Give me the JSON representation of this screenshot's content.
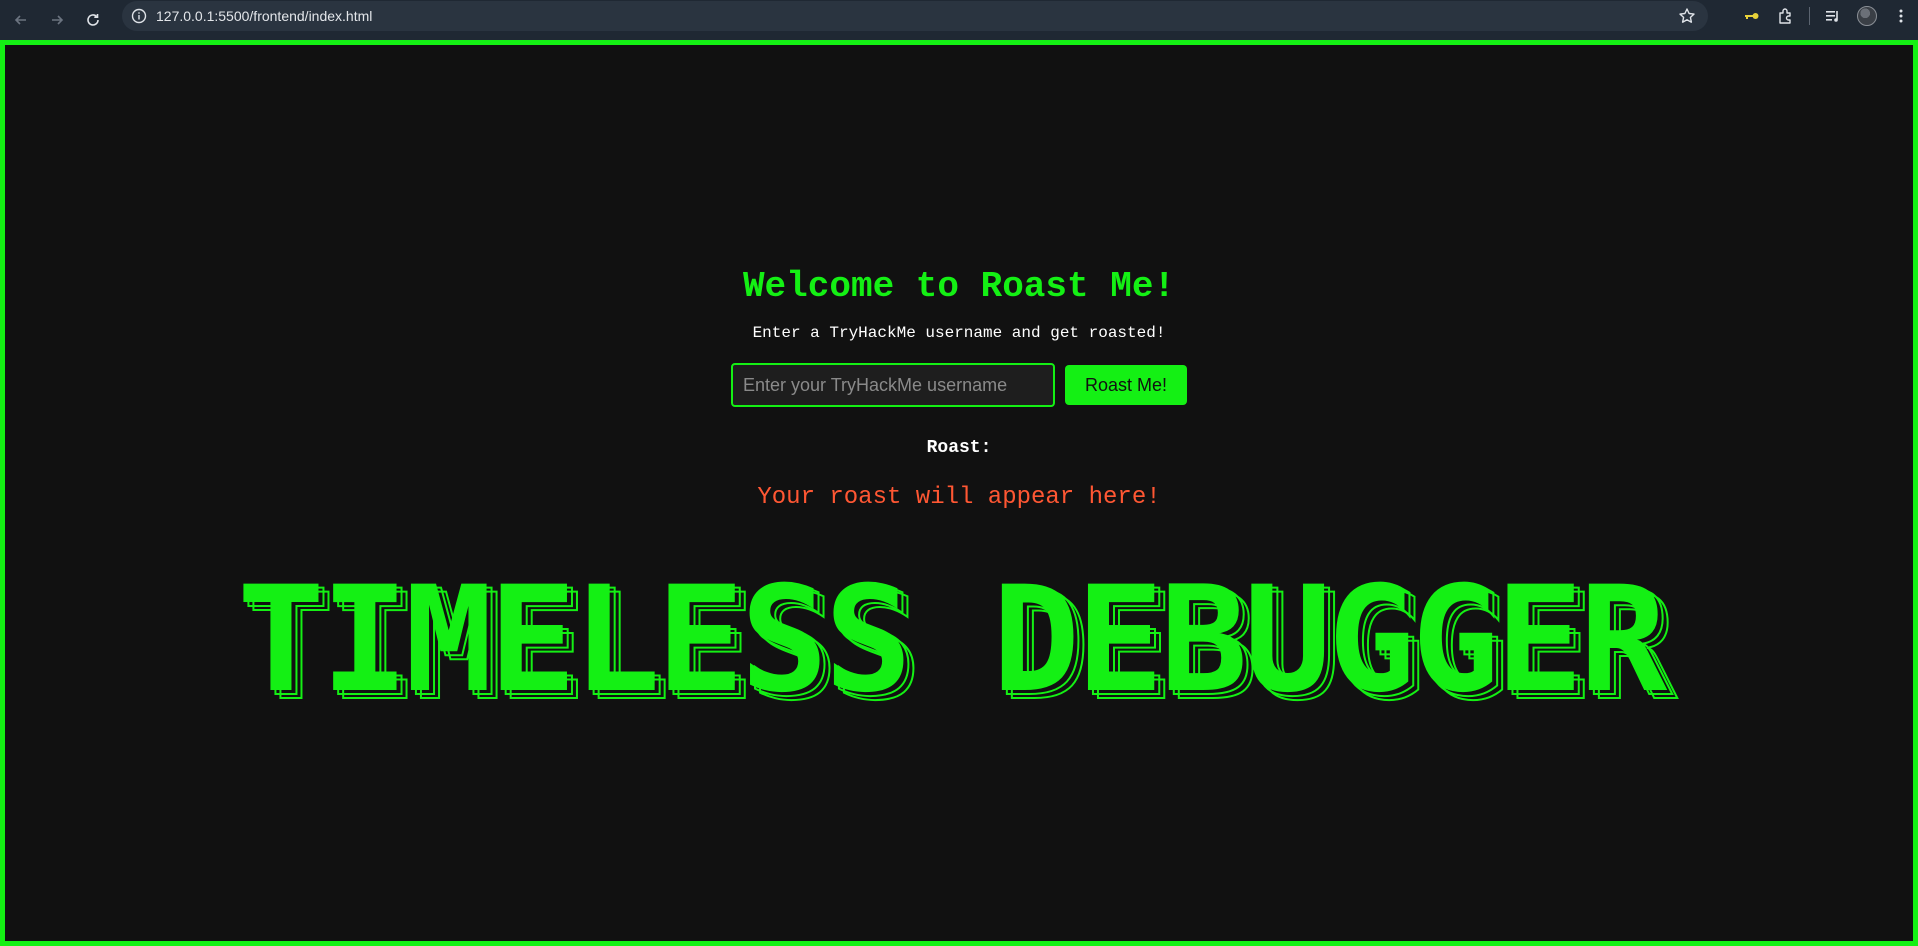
{
  "browser": {
    "url": "127.0.0.1:5500/frontend/index.html"
  },
  "page": {
    "title": "Welcome to Roast Me!",
    "subtitle": "Enter a TryHackMe username and get roasted!",
    "input_placeholder": "Enter your TryHackMe username",
    "input_value": "",
    "button_label": "Roast Me!",
    "roast_label": "Roast:",
    "roast_output": "Your roast will appear here!",
    "banner_text": "TIMELESS DEBUGGER"
  },
  "colors": {
    "accent": "#14f014",
    "background": "#111111",
    "roast_text": "#ff5733"
  },
  "icons": [
    "back-arrow-icon",
    "forward-arrow-icon",
    "reload-icon",
    "site-info-icon",
    "bookmark-star-icon",
    "key-icon",
    "extensions-icon",
    "media-controls-icon",
    "profile-avatar",
    "more-menu-icon"
  ]
}
